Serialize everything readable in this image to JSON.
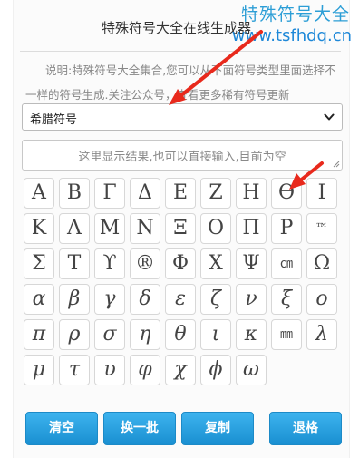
{
  "watermark": {
    "title": "特殊符号大全",
    "url": "www.tsfhdq.cn"
  },
  "header": {
    "title": "特殊符号大全在线生成器"
  },
  "description": "说明:特殊符号大全集合,您可以从下面符号类型里面选择不一样的符号生成.关注公众号，查看更多稀有符号更新",
  "type_select": {
    "selected": "希腊符号"
  },
  "result": {
    "placeholder": "这里显示结果,也可以直接输入,目前为空"
  },
  "symbols": [
    "Α",
    "Β",
    "Γ",
    "Δ",
    "Ε",
    "Ζ",
    "Η",
    "ϴ",
    "Ι",
    "Κ",
    "Λ",
    "Μ",
    "Ν",
    "Ξ",
    "Ο",
    "Π",
    "Ρ",
    "™",
    "Σ",
    "Τ",
    "ϒ",
    "®",
    "Φ",
    "Χ",
    "Ψ",
    "㎝",
    "Ω",
    "α",
    "β",
    "γ",
    "δ",
    "ε",
    "ζ",
    "ν",
    "ξ",
    "ο",
    "π",
    "ρ",
    "σ",
    "η",
    "θ",
    "ι",
    "κ",
    "㎜",
    "λ",
    "μ",
    "τ",
    "υ",
    "φ",
    "χ",
    "ϕ",
    "ω"
  ],
  "buttons": {
    "clear": "清空",
    "shuffle": "换一批",
    "copy": "复制",
    "backspace": "退格"
  },
  "colors": {
    "button_top": "#3db3ee",
    "button_bottom": "#1a8fd1",
    "annotation_arrow": "#e8291c",
    "watermark": "#2c9ed6"
  },
  "icons": {
    "select_caret": "chevron-down-icon",
    "resize": "resize-grip-icon"
  }
}
